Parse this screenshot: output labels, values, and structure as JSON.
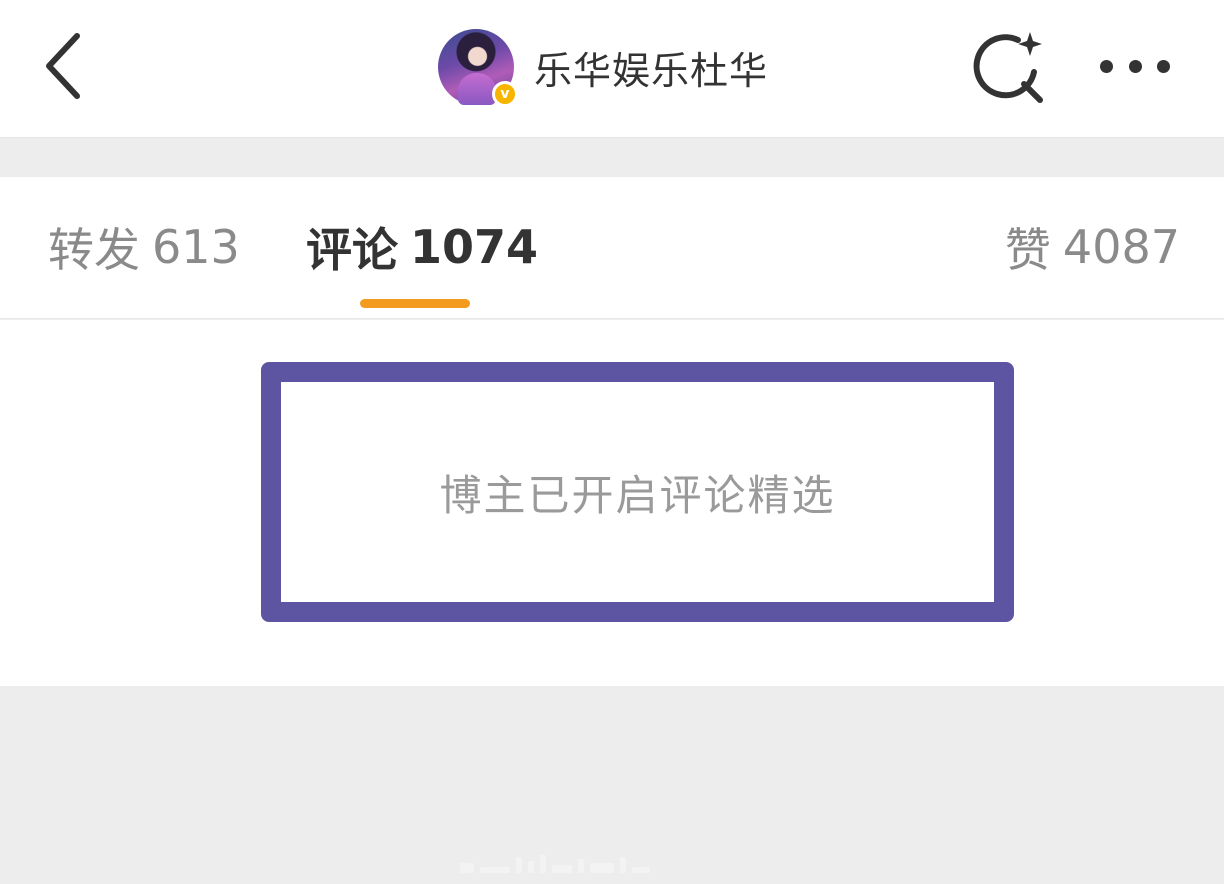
{
  "header": {
    "back_icon": "chevron-left-icon",
    "account_name": "乐华娱乐杜华",
    "verified_badge": "v",
    "search_icon": "search-sparkle-icon",
    "more_icon": "more-dots-icon"
  },
  "tabs": [
    {
      "label": "转发",
      "count": "613",
      "active": false
    },
    {
      "label": "评论",
      "count": "1074",
      "active": true
    },
    {
      "label": "赞",
      "count": "4087",
      "active": false
    }
  ],
  "content": {
    "notice": "博主已开启评论精选"
  },
  "colors": {
    "accent": "#f29b1f",
    "highlight_border": "#5e55a2",
    "verified": "#f7b500",
    "background": "#ededed"
  }
}
